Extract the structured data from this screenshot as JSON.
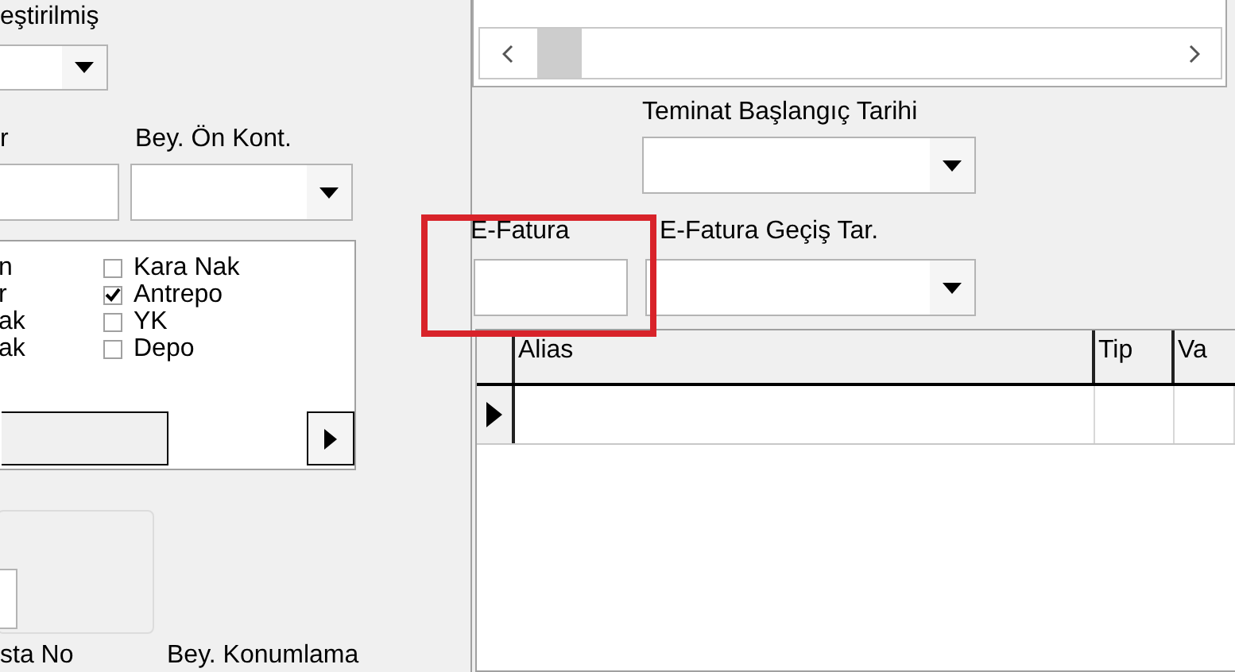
{
  "left_panel": {
    "top_label": "eştirilmiş",
    "field_label": "r",
    "bey_on_kont_label": "Bey. Ön Kont.",
    "option_labels": [
      "n",
      "r",
      "ak",
      "ak"
    ],
    "options": [
      {
        "label": "Kara Nak",
        "checked": false
      },
      {
        "label": "Antrepo",
        "checked": true
      },
      {
        "label": "YK",
        "checked": false
      },
      {
        "label": "Depo",
        "checked": false
      }
    ],
    "bottom_labels": [
      "sta No",
      "Bey. Konumlama"
    ]
  },
  "right_panel": {
    "teminat_label": "Teminat Başlangıç Tarihi",
    "efatura_label": "E-Fatura",
    "efatura_gecis_label": "E-Fatura Geçiş Tar.",
    "grid": {
      "columns": [
        "Alias",
        "Tip",
        "Va"
      ]
    }
  }
}
